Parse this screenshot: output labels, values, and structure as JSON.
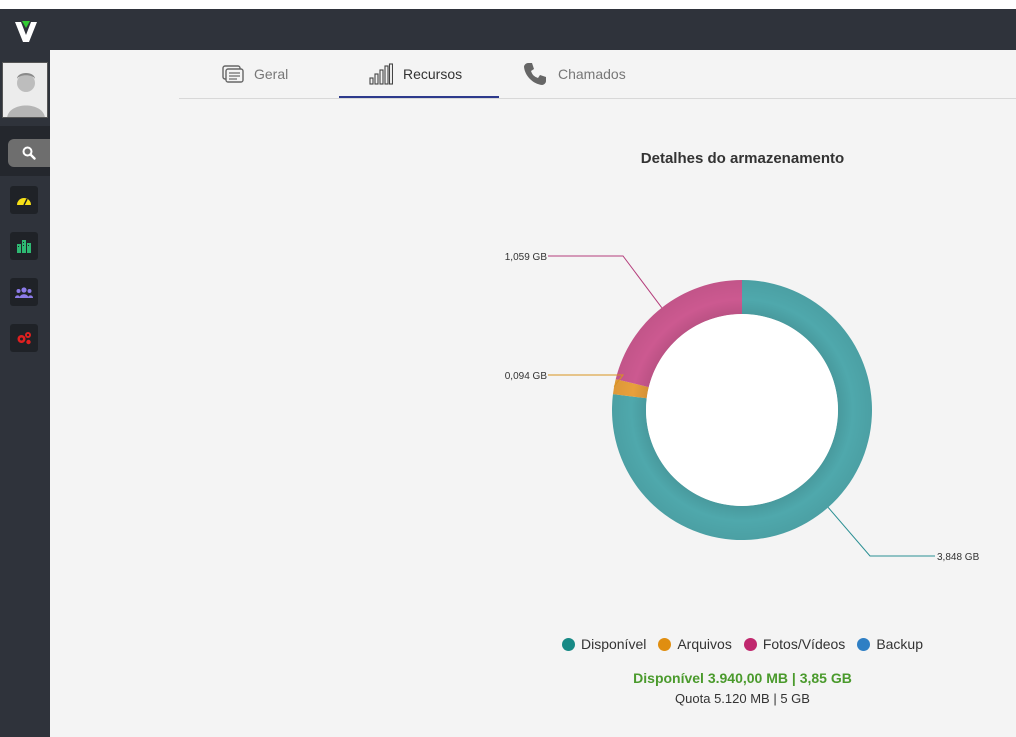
{
  "app": {
    "logo_text": "V"
  },
  "tabs": [
    {
      "label": "Geral",
      "icon": "list-icon",
      "active": false
    },
    {
      "label": "Recursos",
      "icon": "bar-chart-icon",
      "active": true
    },
    {
      "label": "Chamados",
      "icon": "phone-icon",
      "active": false
    }
  ],
  "sidebar": {
    "search_icon": "search-icon",
    "items": [
      {
        "icon": "dashboard-icon",
        "color": "#f7e017"
      },
      {
        "icon": "buildings-icon",
        "color": "#2eb872"
      },
      {
        "icon": "users-icon",
        "color": "#8c7be8"
      },
      {
        "icon": "gears-icon",
        "color": "#e02020"
      }
    ]
  },
  "chart_data": {
    "type": "pie",
    "title": "Detalhes do armazenamento",
    "categories": [
      "Disponível",
      "Arquivos",
      "Fotos/Vídeos",
      "Backup"
    ],
    "values": [
      3.848,
      0.094,
      1.059,
      0
    ],
    "value_labels": [
      "3,848 GB",
      "0,094 GB",
      "1,059 GB",
      ""
    ],
    "colors": [
      "#4fa8ac",
      "#e8a03c",
      "#cc5990",
      "#2f80c8"
    ],
    "legend_colors": [
      "#178985",
      "#e08e10",
      "#c0286e",
      "#2f7fc4"
    ],
    "donut": true,
    "legend": "bottom"
  },
  "summary": {
    "available": "Disponível 3.940,00 MB | 3,85 GB",
    "quota": "Quota 5.120 MB | 5 GB"
  }
}
